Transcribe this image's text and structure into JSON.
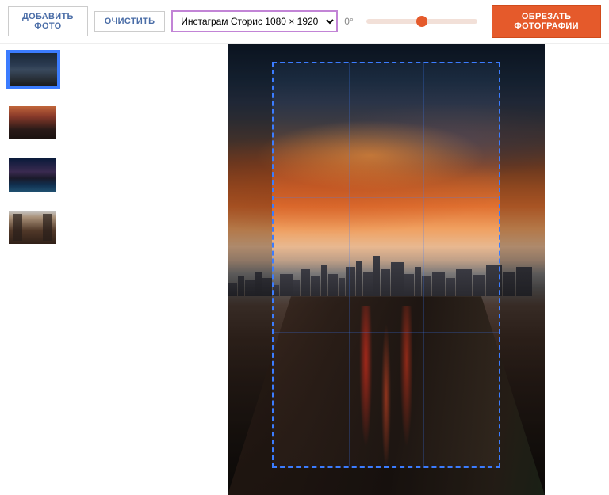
{
  "toolbar": {
    "add_photo_label": "ДОБАВИТЬ ФОТО",
    "clear_label": "ОЧИСТИТЬ",
    "preset_selected": "Инстаграм Сторис 1080 × 1920",
    "rotate_value": "0°",
    "crop_button_label": "ОБРЕЗАТЬ ФОТОГРАФИИ"
  },
  "thumbnails": {
    "items": [
      {
        "name": "city-dusk",
        "active": true
      },
      {
        "name": "street-sunset",
        "active": false
      },
      {
        "name": "night-traffic",
        "active": false
      },
      {
        "name": "bridge-view",
        "active": false
      }
    ]
  },
  "editor": {
    "crop_preset_ratio": "1080x1920",
    "rotation_deg": 0
  }
}
